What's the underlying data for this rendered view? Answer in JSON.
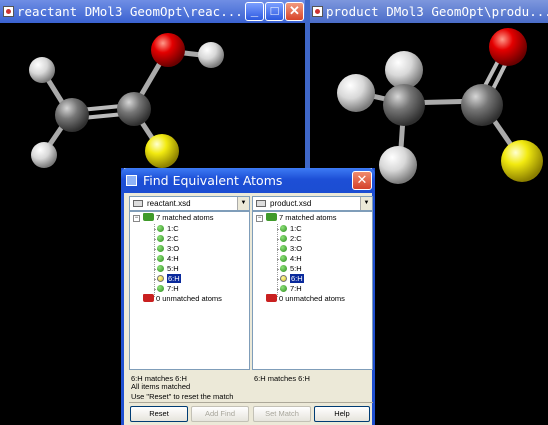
{
  "left_window": {
    "title": "reactant DMol3 GeomOpt\\reac...",
    "minimize": "_",
    "maximize": "□",
    "close": "✕"
  },
  "right_window": {
    "title": "product DMol3 GeomOpt\\produ..."
  },
  "dialog": {
    "title": "Find Equivalent Atoms",
    "close": "✕",
    "left_panel": {
      "file": "reactant.xsd",
      "matched_label": "7 matched atoms",
      "atoms": [
        "1:C",
        "2:C",
        "3:O",
        "4:H",
        "5:H",
        "6:H",
        "7:H"
      ],
      "selected_index": 5,
      "unmatched_label": "0 unmatched atoms",
      "status": "6:H matches  6:H"
    },
    "right_panel": {
      "file": "product.xsd",
      "matched_label": "7 matched atoms",
      "atoms": [
        "1:C",
        "2:C",
        "3:O",
        "4:H",
        "5:H",
        "6:H",
        "7:H"
      ],
      "selected_index": 5,
      "unmatched_label": "0 unmatched atoms",
      "status": "6:H matches  6:H"
    },
    "message_1": "All items matched",
    "message_2": "Use \"Reset\" to reset the match",
    "buttons": {
      "reset": "Reset",
      "add_find": "Add Find",
      "set_match": "Set Match",
      "help": "Help"
    }
  },
  "colors": {
    "carbon": "#6b6b6b",
    "hydrogen": "#e2e2e2",
    "oxygen": "#e00000",
    "sulfur": "#f5ee10",
    "titlebar": "#1f4fd0",
    "dialog_bg": "#ece9d8"
  }
}
